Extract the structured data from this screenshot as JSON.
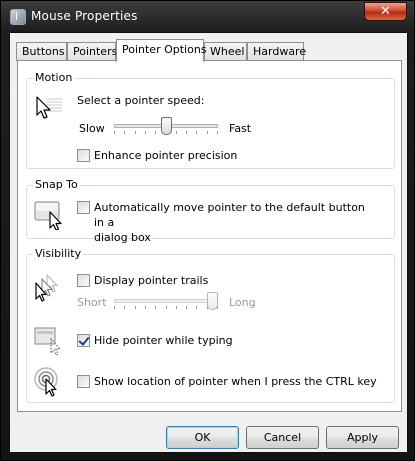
{
  "window": {
    "title": "Mouse Properties",
    "close_glyph": "✕"
  },
  "tabs": [
    {
      "label": "Buttons"
    },
    {
      "label": "Pointers"
    },
    {
      "label": "Pointer Options",
      "active": true
    },
    {
      "label": "Wheel"
    },
    {
      "label": "Hardware"
    }
  ],
  "motion": {
    "group_label": "Motion",
    "icon": "pointer-speed-icon",
    "speed_label": "Select a pointer speed:",
    "slow_label": "Slow",
    "fast_label": "Fast",
    "speed_value": 0.5,
    "enhance_label": "Enhance pointer precision",
    "enhance_checked": false
  },
  "snap_to": {
    "group_label": "Snap To",
    "icon": "snap-to-button-icon",
    "auto_move_label_line1": "Automatically move pointer to the default button in a",
    "auto_move_label_line2": "dialog box",
    "auto_move_checked": false
  },
  "visibility": {
    "group_label": "Visibility",
    "trails_icon": "pointer-trails-icon",
    "trails_label": "Display pointer trails",
    "trails_checked": false,
    "short_label": "Short",
    "long_label": "Long",
    "trail_length_value": 1.0,
    "hide_icon": "hide-pointer-icon",
    "hide_label": "Hide pointer while typing",
    "hide_checked": true,
    "ctrl_icon": "pointer-location-icon",
    "ctrl_label": "Show location of pointer when I press the CTRL key",
    "ctrl_checked": false
  },
  "buttons": {
    "ok": "OK",
    "cancel": "Cancel",
    "apply": "Apply"
  },
  "colors": {
    "titlebar": "#1e1e1e",
    "close_button": "#c83a20",
    "default_button_border": "#3c7fb1",
    "checkmark": "#1d3f7a"
  }
}
